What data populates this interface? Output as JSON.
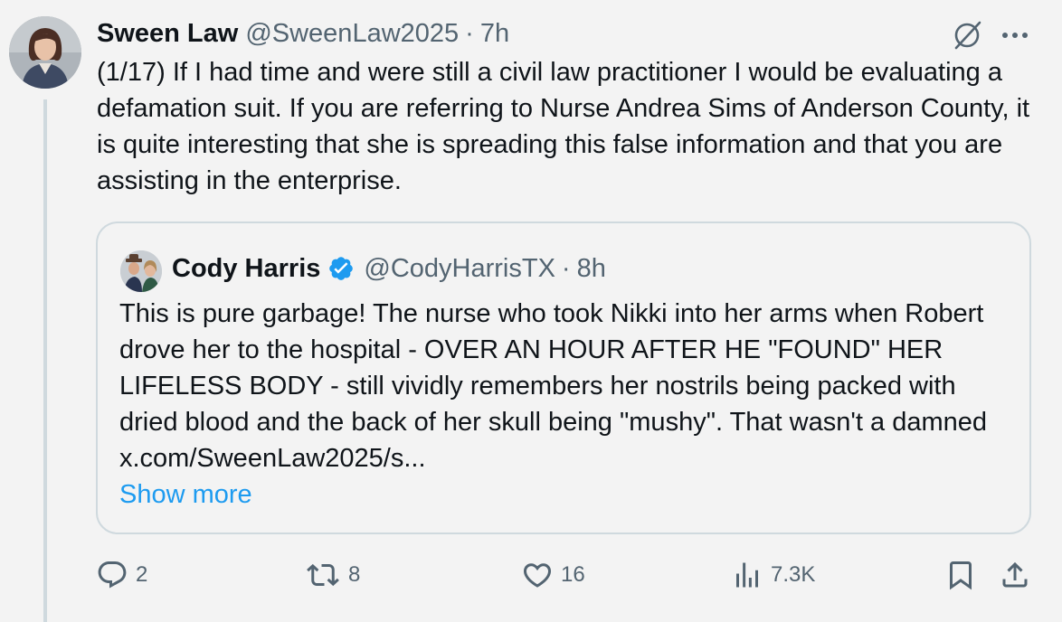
{
  "author": {
    "display_name": "Sween Law",
    "handle": "@SweenLaw2025",
    "separator": "·",
    "time": "7h"
  },
  "post": {
    "text": "(1/17) If I had time and were still a civil law practitioner I would be evaluating a defamation suit. If you are referring to Nurse Andrea Sims of Anderson County, it is quite interesting that she is spreading this false information and that you are assisting in the enterprise."
  },
  "quote": {
    "display_name": "Cody Harris",
    "handle": "@CodyHarrisTX",
    "separator": "·",
    "time": "8h",
    "text": "This is pure garbage! The nurse who took Nikki into her arms when Robert drove her to the hospital - OVER AN HOUR AFTER HE \"FOUND\" HER LIFELESS BODY - still vividly remembers her nostrils being packed with dried blood and the back of her skull being \"mushy\". That wasn't a damned x.com/SweenLaw2025/s...",
    "show_more_label": "Show more",
    "verified_color": "#1d9bf0"
  },
  "actions": {
    "replies": "2",
    "reposts": "8",
    "likes": "16",
    "views": "7.3K"
  },
  "icons": {
    "reply": "reply-icon",
    "repost": "repost-icon",
    "like": "like-icon",
    "views": "views-icon",
    "bookmark": "bookmark-icon",
    "share": "share-icon",
    "grok": "grok-icon",
    "more": "more-icon"
  },
  "colors": {
    "background": "#f3f3f3",
    "text": "#0f1419",
    "secondary": "#536471",
    "link": "#1d9bf0",
    "border": "#cfd9de"
  }
}
